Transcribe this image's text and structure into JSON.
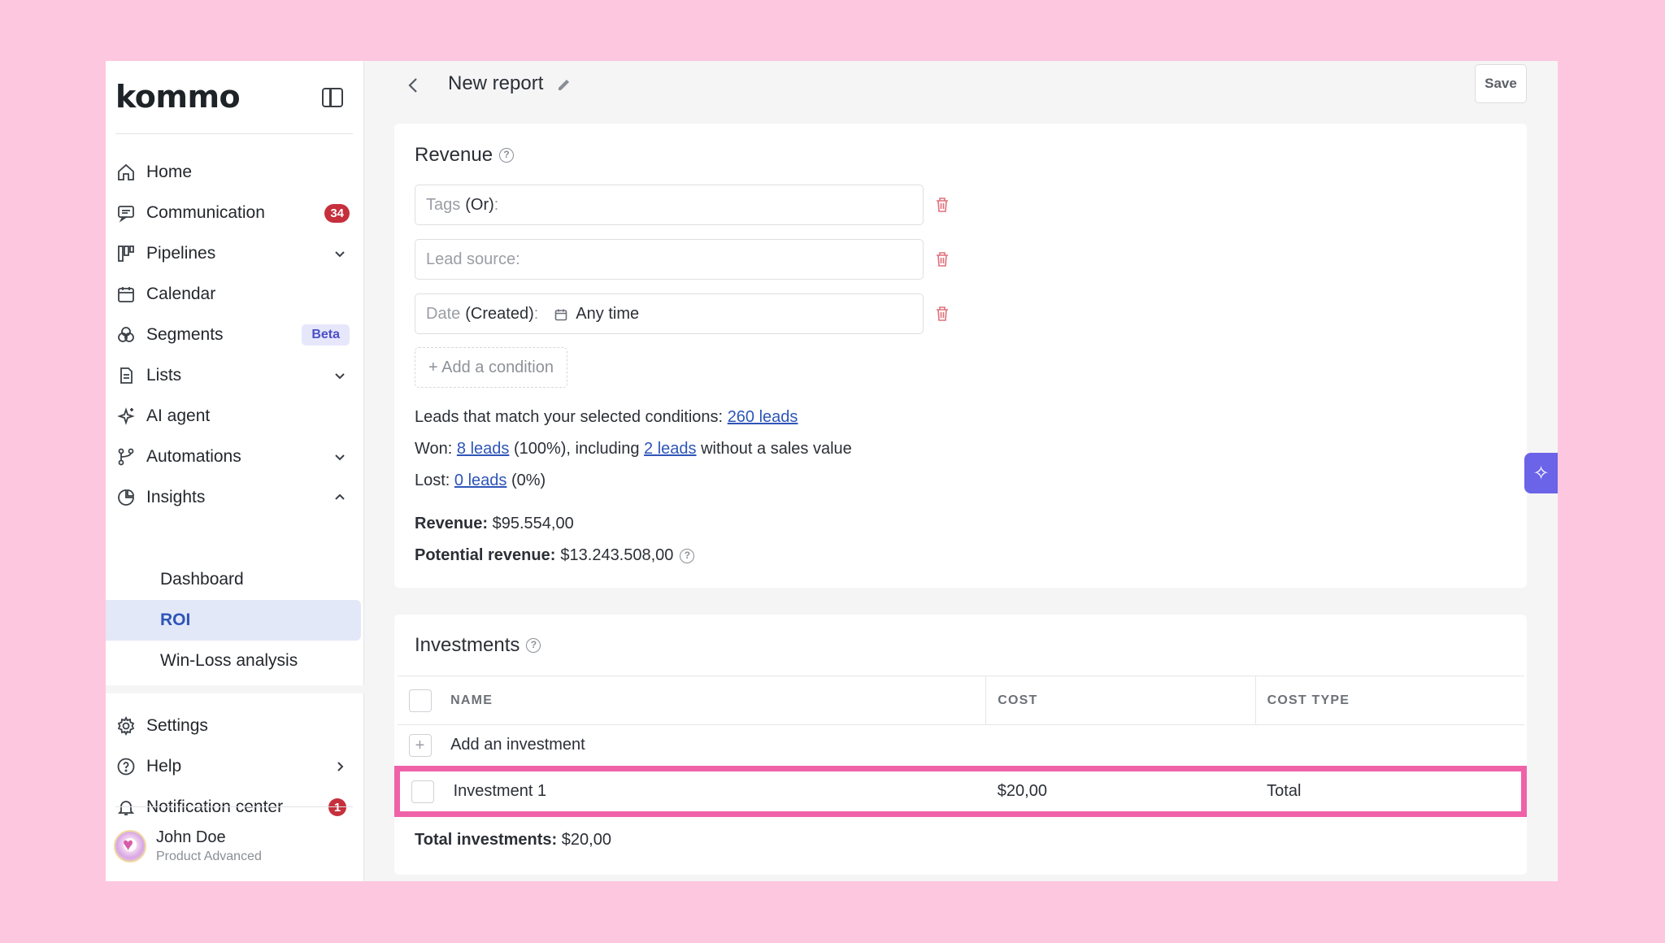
{
  "sidebar": {
    "logo": "kommo",
    "items": [
      {
        "label": "Home",
        "icon": "home-icon"
      },
      {
        "label": "Communication",
        "icon": "chat-icon",
        "badge": "34"
      },
      {
        "label": "Pipelines",
        "icon": "pipelines-icon"
      },
      {
        "label": "Calendar",
        "icon": "calendar-icon"
      },
      {
        "label": "Segments",
        "icon": "segments-icon",
        "badge": "Beta"
      },
      {
        "label": "Lists",
        "icon": "lists-icon"
      },
      {
        "label": "AI agent",
        "icon": "sparkle-icon"
      },
      {
        "label": "Automations",
        "icon": "automations-icon"
      },
      {
        "label": "Insights",
        "icon": "insights-icon"
      }
    ],
    "insights_sub": [
      {
        "label": "Dashboard"
      },
      {
        "label": "ROI"
      },
      {
        "label": "Win-Loss analysis"
      }
    ],
    "lower_items": [
      {
        "label": "Settings",
        "icon": "gear-icon"
      },
      {
        "label": "Help",
        "icon": "help-icon"
      },
      {
        "label": "Notification center",
        "icon": "bell-icon",
        "badge": "1"
      }
    ],
    "user": {
      "name": "John Doe",
      "plan": "Product Advanced"
    }
  },
  "header": {
    "title": "New report",
    "save_label": "Save"
  },
  "revenue": {
    "title": "Revenue",
    "filters": [
      {
        "label": "Tags",
        "value": "(Or)",
        "suffix": ":"
      },
      {
        "label": "Lead source:",
        "value": "",
        "suffix": ""
      },
      {
        "label": "Date",
        "value": "(Created)",
        "suffix": ":",
        "date_value": "Any time"
      }
    ],
    "add_condition": "+ Add a condition",
    "match_text": "Leads that match your selected conditions:",
    "match_link": "260 leads",
    "won_prefix": "Won:",
    "won_link": "8 leads",
    "won_mid": "(100%), including",
    "won_link2": "2 leads",
    "won_suffix": "without a sales value",
    "lost_prefix": "Lost:",
    "lost_link": "0 leads",
    "lost_suffix": "(0%)",
    "revenue_label": "Revenue:",
    "revenue_value": "$95.554,00",
    "potential_label": "Potential revenue:",
    "potential_value": "$13.243.508,00"
  },
  "investments": {
    "title": "Investments",
    "columns": [
      "NAME",
      "COST",
      "COST TYPE"
    ],
    "add_label": "Add an investment",
    "rows": [
      {
        "name": "Investment 1",
        "cost": "$20,00",
        "cost_type": "Total"
      }
    ],
    "total_label": "Total investments:",
    "total_value": "$20,00"
  },
  "colors": {
    "background": "#fdc7df",
    "accent": "#2e55b8",
    "badge": "#c62f3c",
    "highlight": "#f062a8",
    "ai_button": "#6b63e8"
  }
}
